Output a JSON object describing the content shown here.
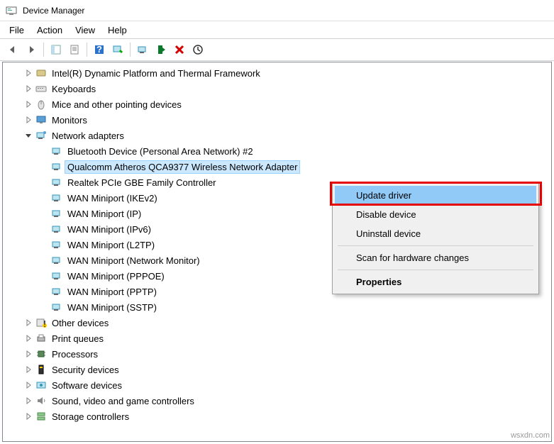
{
  "window": {
    "title": "Device Manager"
  },
  "menu": {
    "file": "File",
    "action": "Action",
    "view": "View",
    "help": "Help"
  },
  "tree": {
    "categories": [
      {
        "label": "Intel(R) Dynamic Platform and Thermal Framework",
        "icon": "generic",
        "expanded": false
      },
      {
        "label": "Keyboards",
        "icon": "keyboard",
        "expanded": false
      },
      {
        "label": "Mice and other pointing devices",
        "icon": "mouse",
        "expanded": false
      },
      {
        "label": "Monitors",
        "icon": "monitor",
        "expanded": false
      },
      {
        "label": "Network adapters",
        "icon": "network",
        "expanded": true
      },
      {
        "label": "Other devices",
        "icon": "other",
        "expanded": false
      },
      {
        "label": "Print queues",
        "icon": "printer",
        "expanded": false
      },
      {
        "label": "Processors",
        "icon": "cpu",
        "expanded": false
      },
      {
        "label": "Security devices",
        "icon": "security",
        "expanded": false
      },
      {
        "label": "Software devices",
        "icon": "software",
        "expanded": false
      },
      {
        "label": "Sound, video and game controllers",
        "icon": "sound",
        "expanded": false
      },
      {
        "label": "Storage controllers",
        "icon": "storage",
        "expanded": false
      }
    ],
    "network_children": [
      {
        "label": "Bluetooth Device (Personal Area Network) #2"
      },
      {
        "label": "Qualcomm Atheros QCA9377 Wireless Network Adapter",
        "selected": true
      },
      {
        "label": "Realtek PCIe GBE Family Controller"
      },
      {
        "label": "WAN Miniport (IKEv2)"
      },
      {
        "label": "WAN Miniport (IP)"
      },
      {
        "label": "WAN Miniport (IPv6)"
      },
      {
        "label": "WAN Miniport (L2TP)"
      },
      {
        "label": "WAN Miniport (Network Monitor)"
      },
      {
        "label": "WAN Miniport (PPPOE)"
      },
      {
        "label": "WAN Miniport (PPTP)"
      },
      {
        "label": "WAN Miniport (SSTP)"
      }
    ]
  },
  "context_menu": {
    "update": "Update driver",
    "disable": "Disable device",
    "uninstall": "Uninstall device",
    "scan": "Scan for hardware changes",
    "properties": "Properties"
  },
  "watermark": "wsxdn.com"
}
